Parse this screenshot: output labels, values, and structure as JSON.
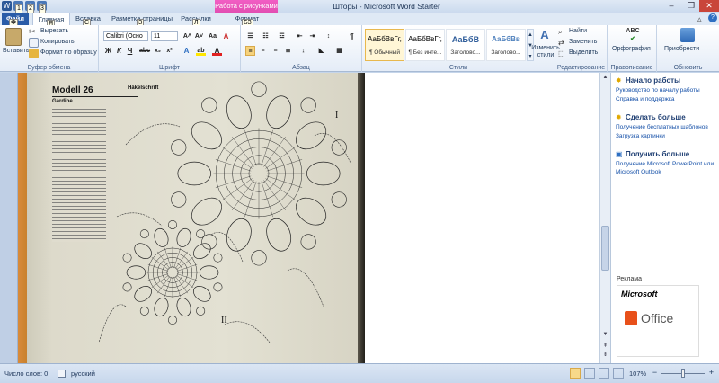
{
  "title_bar": {
    "document_title": "Шторы - Microsoft Word Starter",
    "context_tab": "Работа с рисунками",
    "qat_keytips": [
      "1",
      "2",
      "3"
    ]
  },
  "tabs": [
    {
      "label": "Файл",
      "keytip": "Ф"
    },
    {
      "label": "Главная",
      "keytip": "Я"
    },
    {
      "label": "Вставка",
      "keytip": "С"
    },
    {
      "label": "Разметка страницы",
      "keytip": "З"
    },
    {
      "label": "Рассылки",
      "keytip": "Л"
    },
    {
      "label": "Формат",
      "keytip": "БЗ"
    }
  ],
  "ribbon": {
    "clipboard": {
      "paste": "Вставить",
      "cut": "Вырезать",
      "copy": "Копировать",
      "format_painter": "Формат по образцу",
      "label": "Буфер обмена"
    },
    "font": {
      "font_name": "Calibri (Осно",
      "font_size": "11",
      "label": "Шрифт"
    },
    "paragraph": {
      "label": "Абзац"
    },
    "styles": {
      "items": [
        {
          "sample": "АаБбВвГг,",
          "name": "¶ Обычный"
        },
        {
          "sample": "АаБбВвГг,",
          "name": "¶ Без инте..."
        },
        {
          "sample": "АаБбВ",
          "name": "Заголово..."
        },
        {
          "sample": "АаБбВв",
          "name": "Заголово..."
        }
      ],
      "change_styles": "Изменить стили",
      "label": "Стили"
    },
    "editing": {
      "find": "Найти",
      "replace": "Заменить",
      "select": "Выделить",
      "label": "Редактирование"
    },
    "proofing": {
      "spelling": "Орфография",
      "label": "Правописание"
    },
    "apps": {
      "label_btn": "Приобрести",
      "label": "Обновить"
    }
  },
  "scan": {
    "model": "Modell 26",
    "technique": "Häkelschrift",
    "subtitle": "Gardine",
    "roman1": "I",
    "roman2": "II"
  },
  "task_pane": {
    "getting_started": {
      "heading": "Начало работы",
      "links": [
        "Руководство по началу работы",
        "Справка и поддержка"
      ]
    },
    "do_more": {
      "heading": "Сделать больше",
      "links": [
        "Получение бесплатных шаблонов",
        "Загрузка картинки"
      ]
    },
    "get_more": {
      "heading": "Получить больше",
      "links": [
        "Получение Microsoft PowerPoint или",
        "Microsoft Outlook"
      ]
    },
    "ad_label": "Реклама",
    "ad_brand": "Microsoft",
    "ad_product": "Office"
  },
  "status_bar": {
    "word_count": "Число слов: 0",
    "language": "русский",
    "zoom": "107%"
  },
  "colors": {
    "file_tab": "#2a5ca8",
    "context_tab": "#e24eb2",
    "link": "#1550a8",
    "office_orange": "#e8501a"
  }
}
